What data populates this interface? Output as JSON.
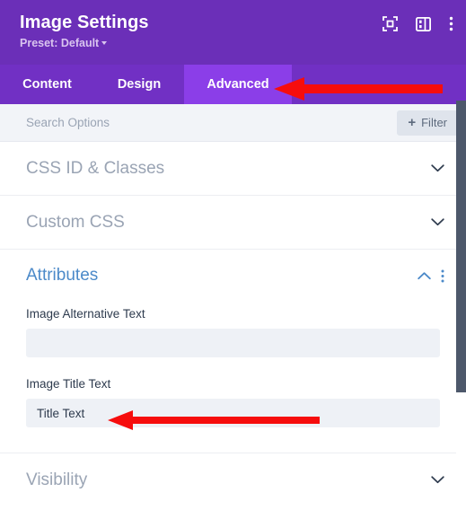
{
  "header": {
    "title": "Image Settings",
    "preset": "Preset: Default",
    "icons": [
      {
        "name": "focus-icon"
      },
      {
        "name": "layout-panel-icon"
      },
      {
        "name": "more-options-icon"
      }
    ]
  },
  "tabs": [
    {
      "label": "Content",
      "active": false
    },
    {
      "label": "Design",
      "active": false
    },
    {
      "label": "Advanced",
      "active": true
    }
  ],
  "search": {
    "placeholder": "Search Options",
    "value": "",
    "filter_label": "Filter",
    "filter_plus": "+"
  },
  "sections": [
    {
      "title": "CSS ID & Classes",
      "state": "collapsed"
    },
    {
      "title": "Custom CSS",
      "state": "collapsed"
    },
    {
      "title": "Attributes",
      "state": "expanded"
    },
    {
      "title": "Visibility",
      "state": "collapsed"
    }
  ],
  "attributes": {
    "alt_label": "Image Alternative Text",
    "alt_value": "",
    "alt_placeholder": "",
    "title_label": "Image Title Text",
    "title_value": "Title Text",
    "title_placeholder": ""
  },
  "annotations": [
    {
      "name": "arrow-pointing-to-advanced-tab",
      "direction": "left",
      "color": "#f60d0d"
    },
    {
      "name": "arrow-pointing-to-title-text-field",
      "direction": "left",
      "color": "#f60d0d"
    }
  ],
  "colors": {
    "header_purple": "#6b2fb8",
    "tabbar_purple": "#7130c4",
    "active_tab_purple": "#8b3ee8",
    "accent_blue": "#4c8ac9",
    "annotation_red": "#f60d0d",
    "field_bg": "#eef1f6",
    "scrollbar": "#4d586b"
  }
}
